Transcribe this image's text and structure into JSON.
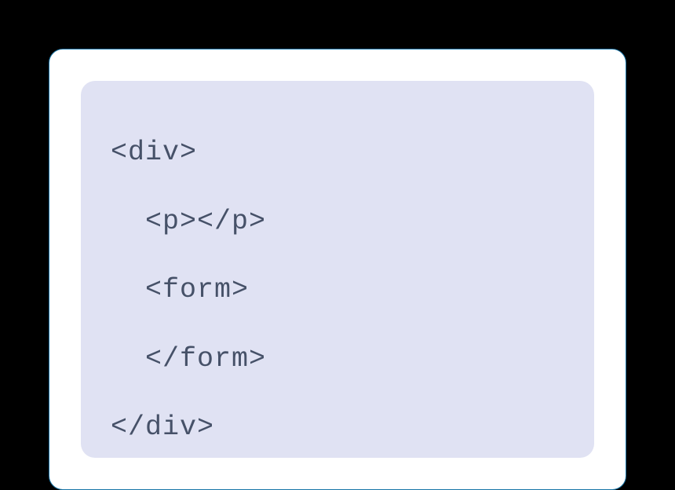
{
  "code": {
    "lines": [
      "<div>",
      "  <p></p>",
      "  <form>",
      "  </form>",
      "</div>"
    ]
  }
}
